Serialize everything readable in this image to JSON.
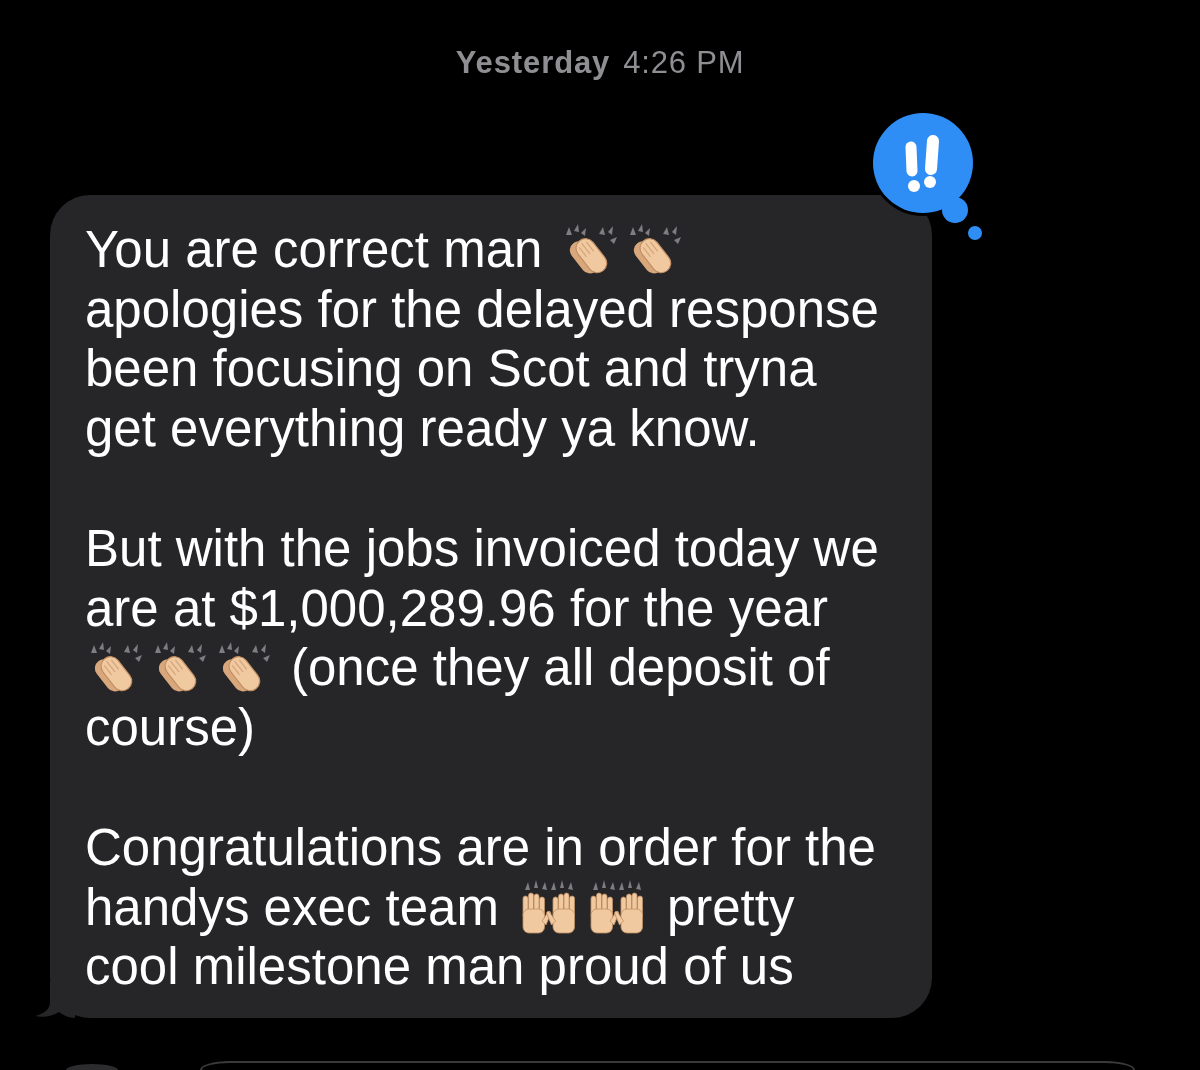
{
  "timestamp": {
    "day": "Yesterday",
    "time": "4:26 PM"
  },
  "message": {
    "paragraphs": [
      {
        "lines": [
          [
            {
              "kind": "text",
              "text": "You are correct man"
            },
            {
              "kind": "clap"
            },
            {
              "kind": "clap"
            }
          ],
          [
            {
              "kind": "text",
              "text": "apologies for the delayed response"
            }
          ],
          [
            {
              "kind": "text",
              "text": "been focusing on Scot and tryna"
            }
          ],
          [
            {
              "kind": "text",
              "text": "get everything ready ya know."
            }
          ]
        ]
      },
      {
        "lines": [
          [
            {
              "kind": "text",
              "text": "But with the jobs invoiced today we"
            }
          ],
          [
            {
              "kind": "text",
              "text": "are at $1,000,289.96 for the year"
            }
          ],
          [
            {
              "kind": "clap"
            },
            {
              "kind": "clap"
            },
            {
              "kind": "clap"
            },
            {
              "kind": "text",
              "text": "(once they all deposit of"
            }
          ],
          [
            {
              "kind": "text",
              "text": "course)"
            }
          ]
        ]
      },
      {
        "lines": [
          [
            {
              "kind": "text",
              "text": "Congratulations are in order for the"
            }
          ],
          [
            {
              "kind": "text",
              "text": "handys exec team"
            },
            {
              "kind": "raise"
            },
            {
              "kind": "raise"
            },
            {
              "kind": "text",
              "text": "pretty"
            }
          ],
          [
            {
              "kind": "text",
              "text": "cool milestone man proud of us"
            }
          ]
        ]
      }
    ]
  }
}
